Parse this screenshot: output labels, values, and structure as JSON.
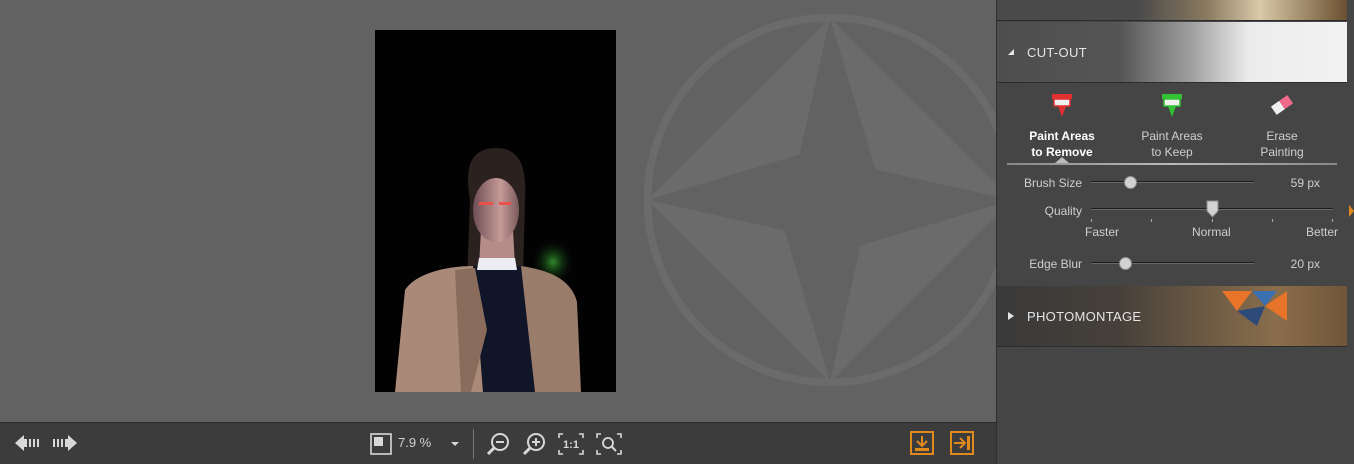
{
  "colors": {
    "accent": "#e08a1e",
    "panel": "#454545",
    "canvas": "#626262",
    "toolbar": "#3c3c3c"
  },
  "panel": {
    "cutout": {
      "title": "CUT-OUT",
      "tools": [
        {
          "label": "Paint Areas\nto Remove",
          "icon": "red-marker-icon",
          "active": true
        },
        {
          "label": "Paint Areas\nto Keep",
          "icon": "green-marker-icon",
          "active": false
        },
        {
          "label": "Erase\nPainting",
          "icon": "eraser-icon",
          "active": false
        }
      ],
      "brush_size": {
        "label": "Brush Size",
        "value": "59 px",
        "level": 0.24
      },
      "quality": {
        "label": "Quality",
        "faster": "Faster",
        "normal": "Normal",
        "better": "Better",
        "level": 0.5
      },
      "edge_blur": {
        "label": "Edge Blur",
        "value": "20 px",
        "level": 0.21
      }
    },
    "photomontage": {
      "title": "PHOTOMONTAGE"
    }
  },
  "toolbar": {
    "zoom_value": "7.9 %",
    "icons": [
      "prev-image-icon",
      "next-image-icon",
      "fit-view-icon",
      "zoom-dropdown-icon",
      "zoom-out-icon",
      "zoom-in-icon",
      "actual-size-icon",
      "zoom-to-fit-icon",
      "save-icon",
      "export-icon"
    ]
  }
}
